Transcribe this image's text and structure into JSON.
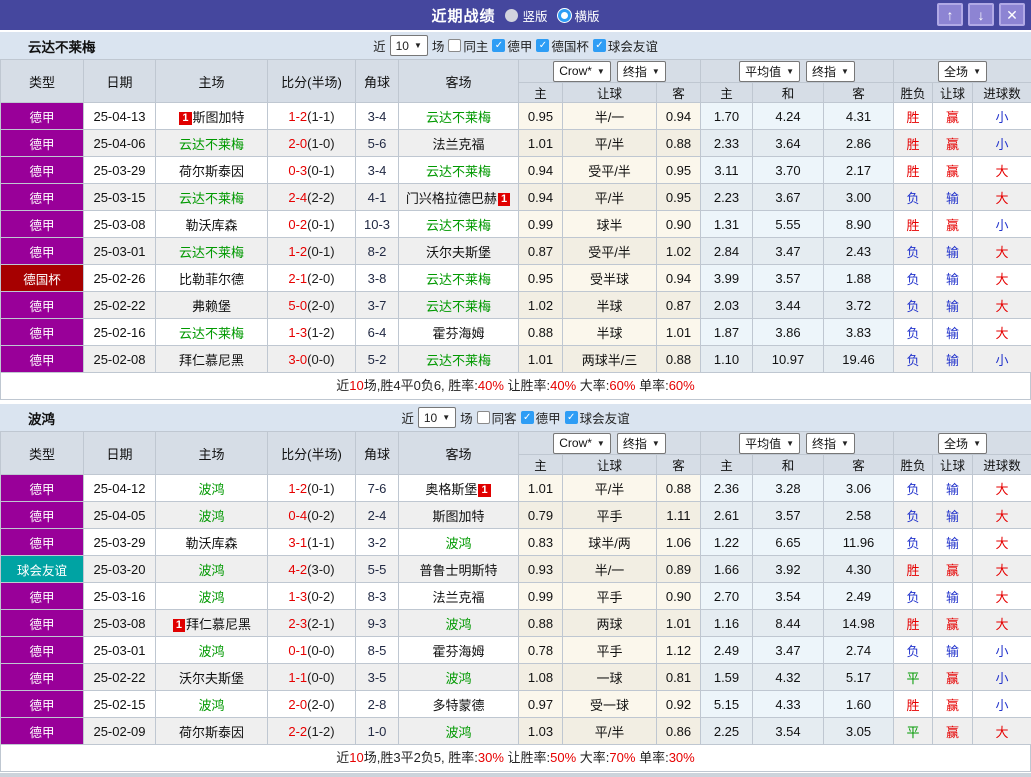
{
  "colors": {
    "titlebar_bg": "#45479e",
    "button_bg": "#8d84d3",
    "button_border": "#b1a9e6",
    "filter_bg": "#dae4f0",
    "header_bg": "#d6dde6",
    "grid": "#bfc7d1",
    "league": "#990099",
    "cup": "#a60000",
    "friendly": "#00a3a3",
    "team_green": "#009900",
    "score_red": "#e60000",
    "red": "#e60000",
    "blue": "#2233cc",
    "green": "#009900",
    "corner": "#222a44",
    "cream": "#fbf7ec",
    "lblue": "#edf5fa",
    "check_blue": "#2e9df5"
  },
  "titlebar": {
    "title": "近期战绩",
    "radio_vertical": "竖版",
    "radio_horizontal": "横版",
    "up_icon": "↑",
    "down_icon": "↓",
    "close_icon": "✕"
  },
  "controls": {
    "near": "近",
    "count": "10",
    "games": "场"
  },
  "selects": {
    "crow": "Crow*",
    "final": "终指",
    "avg": "平均值",
    "final2": "终指",
    "full": "全场"
  },
  "columns": {
    "type": "类型",
    "date": "日期",
    "home": "主场",
    "score": "比分(半场)",
    "corner": "角球",
    "away": "客场",
    "sub": [
      "主",
      "让球",
      "客",
      "主",
      "和",
      "客",
      "胜负",
      "让球",
      "进球数"
    ]
  },
  "icons": {
    "check": "✓",
    "chevron": "▼"
  },
  "sections": [
    {
      "team": "云达不莱梅",
      "filter": {
        "same": "同主",
        "same_checked": false,
        "leagues": [
          {
            "label": "德甲",
            "checked": true
          },
          {
            "label": "德国杯",
            "checked": true
          },
          {
            "label": "球会友谊",
            "checked": true
          }
        ]
      },
      "rows": [
        {
          "type": "德甲",
          "type_style": "league",
          "date": "25-04-13",
          "home": {
            "name": "斯图加特",
            "self": false,
            "badge": "1",
            "badge_pos": "before"
          },
          "score": "1-2",
          "half": "(1-1)",
          "corner": "3-4",
          "away": {
            "name": "云达不莱梅",
            "self": true
          },
          "odds": [
            "0.95",
            "半/一",
            "0.94"
          ],
          "avg": [
            "1.70",
            "4.24",
            "4.31"
          ],
          "res": [
            {
              "t": "胜",
              "c": "r"
            },
            {
              "t": "赢",
              "c": "r"
            },
            {
              "t": "小",
              "c": "b"
            }
          ]
        },
        {
          "type": "德甲",
          "type_style": "league",
          "date": "25-04-06",
          "home": {
            "name": "云达不莱梅",
            "self": true
          },
          "score": "2-0",
          "half": "(1-0)",
          "corner": "5-6",
          "away": {
            "name": "法兰克福",
            "self": false
          },
          "odds": [
            "1.01",
            "平/半",
            "0.88"
          ],
          "avg": [
            "2.33",
            "3.64",
            "2.86"
          ],
          "res": [
            {
              "t": "胜",
              "c": "r"
            },
            {
              "t": "赢",
              "c": "r"
            },
            {
              "t": "小",
              "c": "b"
            }
          ]
        },
        {
          "type": "德甲",
          "type_style": "league",
          "date": "25-03-29",
          "home": {
            "name": "荷尔斯泰因",
            "self": false
          },
          "score": "0-3",
          "half": "(0-1)",
          "corner": "3-4",
          "away": {
            "name": "云达不莱梅",
            "self": true
          },
          "odds": [
            "0.94",
            "受平/半",
            "0.95"
          ],
          "avg": [
            "3.11",
            "3.70",
            "2.17"
          ],
          "res": [
            {
              "t": "胜",
              "c": "r"
            },
            {
              "t": "赢",
              "c": "r"
            },
            {
              "t": "大",
              "c": "r"
            }
          ]
        },
        {
          "type": "德甲",
          "type_style": "league",
          "date": "25-03-15",
          "home": {
            "name": "云达不莱梅",
            "self": true
          },
          "score": "2-4",
          "half": "(2-2)",
          "corner": "4-1",
          "away": {
            "name": "门兴格拉德巴赫",
            "self": false,
            "badge": "1",
            "badge_pos": "after"
          },
          "odds": [
            "0.94",
            "平/半",
            "0.95"
          ],
          "avg": [
            "2.23",
            "3.67",
            "3.00"
          ],
          "res": [
            {
              "t": "负",
              "c": "b"
            },
            {
              "t": "输",
              "c": "b"
            },
            {
              "t": "大",
              "c": "r"
            }
          ]
        },
        {
          "type": "德甲",
          "type_style": "league",
          "date": "25-03-08",
          "home": {
            "name": "勒沃库森",
            "self": false
          },
          "score": "0-2",
          "half": "(0-1)",
          "corner": "10-3",
          "away": {
            "name": "云达不莱梅",
            "self": true
          },
          "odds": [
            "0.99",
            "球半",
            "0.90"
          ],
          "avg": [
            "1.31",
            "5.55",
            "8.90"
          ],
          "res": [
            {
              "t": "胜",
              "c": "r"
            },
            {
              "t": "赢",
              "c": "r"
            },
            {
              "t": "小",
              "c": "b"
            }
          ]
        },
        {
          "type": "德甲",
          "type_style": "league",
          "date": "25-03-01",
          "home": {
            "name": "云达不莱梅",
            "self": true
          },
          "score": "1-2",
          "half": "(0-1)",
          "corner": "8-2",
          "away": {
            "name": "沃尔夫斯堡",
            "self": false
          },
          "odds": [
            "0.87",
            "受平/半",
            "1.02"
          ],
          "avg": [
            "2.84",
            "3.47",
            "2.43"
          ],
          "res": [
            {
              "t": "负",
              "c": "b"
            },
            {
              "t": "输",
              "c": "b"
            },
            {
              "t": "大",
              "c": "r"
            }
          ]
        },
        {
          "type": "德国杯",
          "type_style": "cup",
          "date": "25-02-26",
          "home": {
            "name": "比勒菲尔德",
            "self": false
          },
          "score": "2-1",
          "half": "(2-0)",
          "corner": "3-8",
          "away": {
            "name": "云达不莱梅",
            "self": true
          },
          "odds": [
            "0.95",
            "受半球",
            "0.94"
          ],
          "avg": [
            "3.99",
            "3.57",
            "1.88"
          ],
          "res": [
            {
              "t": "负",
              "c": "b"
            },
            {
              "t": "输",
              "c": "b"
            },
            {
              "t": "大",
              "c": "r"
            }
          ]
        },
        {
          "type": "德甲",
          "type_style": "league",
          "date": "25-02-22",
          "home": {
            "name": "弗赖堡",
            "self": false
          },
          "score": "5-0",
          "half": "(2-0)",
          "corner": "3-7",
          "away": {
            "name": "云达不莱梅",
            "self": true
          },
          "odds": [
            "1.02",
            "半球",
            "0.87"
          ],
          "avg": [
            "2.03",
            "3.44",
            "3.72"
          ],
          "res": [
            {
              "t": "负",
              "c": "b"
            },
            {
              "t": "输",
              "c": "b"
            },
            {
              "t": "大",
              "c": "r"
            }
          ]
        },
        {
          "type": "德甲",
          "type_style": "league",
          "date": "25-02-16",
          "home": {
            "name": "云达不莱梅",
            "self": true
          },
          "score": "1-3",
          "half": "(1-2)",
          "corner": "6-4",
          "away": {
            "name": "霍芬海姆",
            "self": false
          },
          "odds": [
            "0.88",
            "半球",
            "1.01"
          ],
          "avg": [
            "1.87",
            "3.86",
            "3.83"
          ],
          "res": [
            {
              "t": "负",
              "c": "b"
            },
            {
              "t": "输",
              "c": "b"
            },
            {
              "t": "大",
              "c": "r"
            }
          ]
        },
        {
          "type": "德甲",
          "type_style": "league",
          "date": "25-02-08",
          "home": {
            "name": "拜仁慕尼黑",
            "self": false
          },
          "score": "3-0",
          "half": "(0-0)",
          "corner": "5-2",
          "away": {
            "name": "云达不莱梅",
            "self": true
          },
          "odds": [
            "1.01",
            "两球半/三",
            "0.88"
          ],
          "avg": [
            "1.10",
            "10.97",
            "19.46"
          ],
          "res": [
            {
              "t": "负",
              "c": "b"
            },
            {
              "t": "输",
              "c": "b"
            },
            {
              "t": "小",
              "c": "b"
            }
          ]
        }
      ],
      "summary": [
        {
          "t": "近",
          "c": "k"
        },
        {
          "t": "10",
          "c": "r"
        },
        {
          "t": "场,胜4平0负6, 胜率:",
          "c": "k"
        },
        {
          "t": "40%",
          "c": "r"
        },
        {
          "t": " 让胜率:",
          "c": "k"
        },
        {
          "t": "40%",
          "c": "r"
        },
        {
          "t": " 大率:",
          "c": "k"
        },
        {
          "t": "60%",
          "c": "r"
        },
        {
          "t": " 单率:",
          "c": "k"
        },
        {
          "t": "60%",
          "c": "r"
        }
      ]
    },
    {
      "team": "波鸿",
      "filter": {
        "same": "同客",
        "same_checked": false,
        "leagues": [
          {
            "label": "德甲",
            "checked": true
          },
          {
            "label": "球会友谊",
            "checked": true
          }
        ]
      },
      "rows": [
        {
          "type": "德甲",
          "type_style": "league",
          "date": "25-04-12",
          "home": {
            "name": "波鸿",
            "self": true
          },
          "score": "1-2",
          "half": "(0-1)",
          "corner": "7-6",
          "away": {
            "name": "奥格斯堡",
            "self": false,
            "badge": "1",
            "badge_pos": "after"
          },
          "odds": [
            "1.01",
            "平/半",
            "0.88"
          ],
          "avg": [
            "2.36",
            "3.28",
            "3.06"
          ],
          "res": [
            {
              "t": "负",
              "c": "b"
            },
            {
              "t": "输",
              "c": "b"
            },
            {
              "t": "大",
              "c": "r"
            }
          ]
        },
        {
          "type": "德甲",
          "type_style": "league",
          "date": "25-04-05",
          "home": {
            "name": "波鸿",
            "self": true
          },
          "score": "0-4",
          "half": "(0-2)",
          "corner": "2-4",
          "away": {
            "name": "斯图加特",
            "self": false
          },
          "odds": [
            "0.79",
            "平手",
            "1.11"
          ],
          "avg": [
            "2.61",
            "3.57",
            "2.58"
          ],
          "res": [
            {
              "t": "负",
              "c": "b"
            },
            {
              "t": "输",
              "c": "b"
            },
            {
              "t": "大",
              "c": "r"
            }
          ]
        },
        {
          "type": "德甲",
          "type_style": "league",
          "date": "25-03-29",
          "home": {
            "name": "勒沃库森",
            "self": false
          },
          "score": "3-1",
          "half": "(1-1)",
          "corner": "3-2",
          "away": {
            "name": "波鸿",
            "self": true
          },
          "odds": [
            "0.83",
            "球半/两",
            "1.06"
          ],
          "avg": [
            "1.22",
            "6.65",
            "11.96"
          ],
          "res": [
            {
              "t": "负",
              "c": "b"
            },
            {
              "t": "输",
              "c": "b"
            },
            {
              "t": "大",
              "c": "r"
            }
          ]
        },
        {
          "type": "球会友谊",
          "type_style": "friendly",
          "date": "25-03-20",
          "home": {
            "name": "波鸿",
            "self": true
          },
          "score": "4-2",
          "half": "(3-0)",
          "corner": "5-5",
          "away": {
            "name": "普鲁士明斯特",
            "self": false
          },
          "odds": [
            "0.93",
            "半/一",
            "0.89"
          ],
          "avg": [
            "1.66",
            "3.92",
            "4.30"
          ],
          "res": [
            {
              "t": "胜",
              "c": "r"
            },
            {
              "t": "赢",
              "c": "r"
            },
            {
              "t": "大",
              "c": "r"
            }
          ]
        },
        {
          "type": "德甲",
          "type_style": "league",
          "date": "25-03-16",
          "home": {
            "name": "波鸿",
            "self": true
          },
          "score": "1-3",
          "half": "(0-2)",
          "corner": "8-3",
          "away": {
            "name": "法兰克福",
            "self": false
          },
          "odds": [
            "0.99",
            "平手",
            "0.90"
          ],
          "avg": [
            "2.70",
            "3.54",
            "2.49"
          ],
          "res": [
            {
              "t": "负",
              "c": "b"
            },
            {
              "t": "输",
              "c": "b"
            },
            {
              "t": "大",
              "c": "r"
            }
          ]
        },
        {
          "type": "德甲",
          "type_style": "league",
          "date": "25-03-08",
          "home": {
            "name": "拜仁慕尼黑",
            "self": false,
            "badge": "1",
            "badge_pos": "before"
          },
          "score": "2-3",
          "half": "(2-1)",
          "corner": "9-3",
          "away": {
            "name": "波鸿",
            "self": true
          },
          "odds": [
            "0.88",
            "两球",
            "1.01"
          ],
          "avg": [
            "1.16",
            "8.44",
            "14.98"
          ],
          "res": [
            {
              "t": "胜",
              "c": "r"
            },
            {
              "t": "赢",
              "c": "r"
            },
            {
              "t": "大",
              "c": "r"
            }
          ]
        },
        {
          "type": "德甲",
          "type_style": "league",
          "date": "25-03-01",
          "home": {
            "name": "波鸿",
            "self": true
          },
          "score": "0-1",
          "half": "(0-0)",
          "corner": "8-5",
          "away": {
            "name": "霍芬海姆",
            "self": false
          },
          "odds": [
            "0.78",
            "平手",
            "1.12"
          ],
          "avg": [
            "2.49",
            "3.47",
            "2.74"
          ],
          "res": [
            {
              "t": "负",
              "c": "b"
            },
            {
              "t": "输",
              "c": "b"
            },
            {
              "t": "小",
              "c": "b"
            }
          ]
        },
        {
          "type": "德甲",
          "type_style": "league",
          "date": "25-02-22",
          "home": {
            "name": "沃尔夫斯堡",
            "self": false
          },
          "score": "1-1",
          "half": "(0-0)",
          "corner": "3-5",
          "away": {
            "name": "波鸿",
            "self": true
          },
          "odds": [
            "1.08",
            "一球",
            "0.81"
          ],
          "avg": [
            "1.59",
            "4.32",
            "5.17"
          ],
          "res": [
            {
              "t": "平",
              "c": "g"
            },
            {
              "t": "赢",
              "c": "r"
            },
            {
              "t": "小",
              "c": "b"
            }
          ]
        },
        {
          "type": "德甲",
          "type_style": "league",
          "date": "25-02-15",
          "home": {
            "name": "波鸿",
            "self": true
          },
          "score": "2-0",
          "half": "(2-0)",
          "corner": "2-8",
          "away": {
            "name": "多特蒙德",
            "self": false
          },
          "odds": [
            "0.97",
            "受一球",
            "0.92"
          ],
          "avg": [
            "5.15",
            "4.33",
            "1.60"
          ],
          "res": [
            {
              "t": "胜",
              "c": "r"
            },
            {
              "t": "赢",
              "c": "r"
            },
            {
              "t": "小",
              "c": "b"
            }
          ]
        },
        {
          "type": "德甲",
          "type_style": "league",
          "date": "25-02-09",
          "home": {
            "name": "荷尔斯泰因",
            "self": false
          },
          "score": "2-2",
          "half": "(1-2)",
          "corner": "1-0",
          "away": {
            "name": "波鸿",
            "self": true
          },
          "odds": [
            "1.03",
            "平/半",
            "0.86"
          ],
          "avg": [
            "2.25",
            "3.54",
            "3.05"
          ],
          "res": [
            {
              "t": "平",
              "c": "g"
            },
            {
              "t": "赢",
              "c": "r"
            },
            {
              "t": "大",
              "c": "r"
            }
          ]
        }
      ],
      "summary": [
        {
          "t": "近",
          "c": "k"
        },
        {
          "t": "10",
          "c": "r"
        },
        {
          "t": "场,胜3平2负5, 胜率:",
          "c": "k"
        },
        {
          "t": "30%",
          "c": "r"
        },
        {
          "t": " 让胜率:",
          "c": "k"
        },
        {
          "t": "50%",
          "c": "r"
        },
        {
          "t": " 大率:",
          "c": "k"
        },
        {
          "t": "70%",
          "c": "r"
        },
        {
          "t": " 单率:",
          "c": "k"
        },
        {
          "t": "30%",
          "c": "r"
        }
      ]
    }
  ]
}
